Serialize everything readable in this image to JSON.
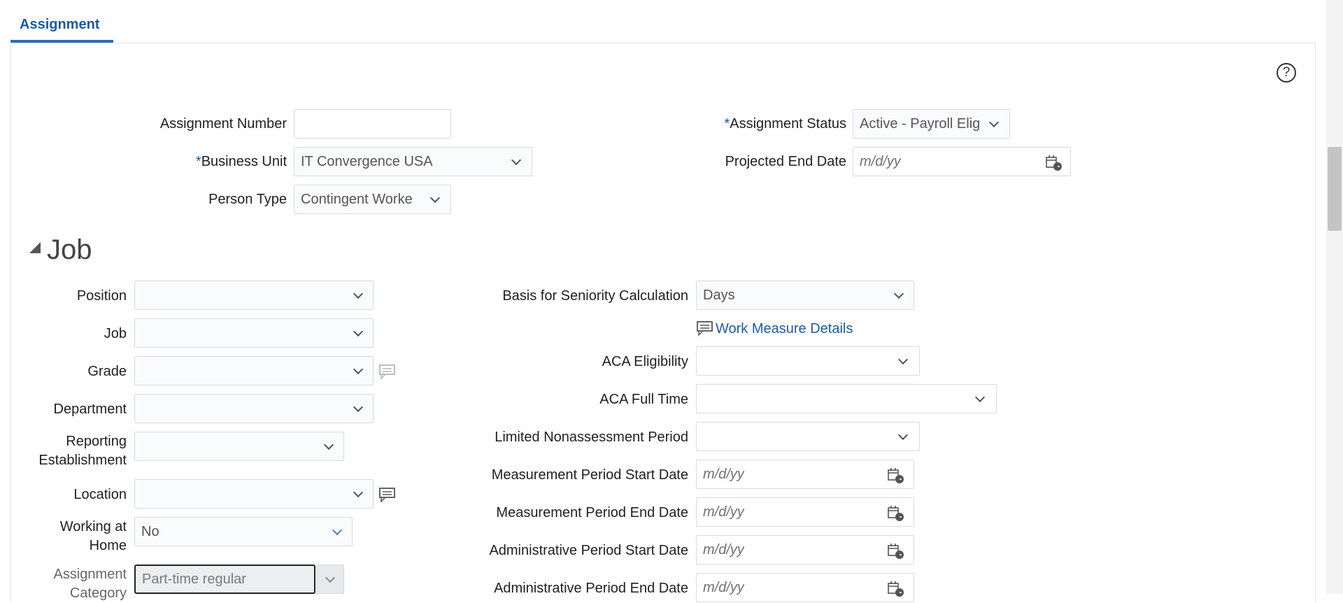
{
  "tab": {
    "label": "Assignment"
  },
  "help": {
    "glyph": "?"
  },
  "header_fields": {
    "assignment_number": {
      "label": "Assignment Number",
      "value": ""
    },
    "business_unit": {
      "required": "*",
      "label": "Business Unit",
      "value": "IT Convergence USA"
    },
    "person_type": {
      "label": "Person Type",
      "value": "Contingent Worke"
    },
    "assignment_status": {
      "required": "*",
      "label": "Assignment Status",
      "value": "Active - Payroll Elig"
    },
    "projected_end_date": {
      "label": "Projected End Date",
      "placeholder": "m/d/yy"
    }
  },
  "job_section": {
    "title": "Job",
    "left": {
      "position": {
        "label": "Position",
        "value": ""
      },
      "job": {
        "label": "Job",
        "value": ""
      },
      "grade": {
        "label": "Grade",
        "value": ""
      },
      "department": {
        "label": "Department",
        "value": ""
      },
      "reporting_establishment": {
        "label_line1": "Reporting",
        "label_line2": "Establishment",
        "value": ""
      },
      "location": {
        "label": "Location",
        "value": ""
      },
      "working_at_home": {
        "label_line1": "Working at",
        "label_line2": "Home",
        "value": "No"
      },
      "assignment_category": {
        "label_line1": "Assignment",
        "label_line2": "Category",
        "value": "Part-time regular"
      }
    },
    "right": {
      "basis_for_seniority": {
        "label": "Basis for Seniority Calculation",
        "value": "Days"
      },
      "work_measure_link": "Work Measure Details",
      "aca_eligibility": {
        "label": "ACA Eligibility",
        "value": ""
      },
      "aca_full_time": {
        "label": "ACA Full Time",
        "value": ""
      },
      "limited_nonassessment": {
        "label": "Limited Nonassessment Period",
        "value": ""
      },
      "measurement_start": {
        "label": "Measurement Period Start Date",
        "placeholder": "m/d/yy"
      },
      "measurement_end": {
        "label": "Measurement Period End Date",
        "placeholder": "m/d/yy"
      },
      "admin_start": {
        "label": "Administrative Period Start Date",
        "placeholder": "m/d/yy"
      },
      "admin_end": {
        "label": "Administrative Period End Date",
        "placeholder": "m/d/yy"
      }
    }
  },
  "colors": {
    "accent": "#1e5aa0",
    "border": "#d6dbe1"
  },
  "icons": [
    "help-icon",
    "chevron-down-icon",
    "calendar-icon",
    "details-icon",
    "collapse-triangle-icon"
  ]
}
